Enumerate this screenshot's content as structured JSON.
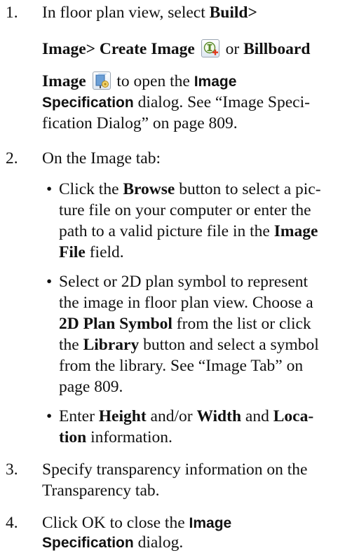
{
  "steps": [
    {
      "number": "1.",
      "lines": [
        {
          "t1": "In floor plan view, select ",
          "b1": "Build>"
        },
        {
          "b1": "Image> Create Image",
          "icon1": "create-image-icon",
          "t2": " or ",
          "b2": "Billboard"
        },
        {
          "b1": "Image",
          "icon1": "billboard-image-icon",
          "t1": " to open the ",
          "s1": "Image"
        },
        {
          "s1": "Specification",
          "t1": " dialog. See “Image Speci-"
        },
        {
          "t1": "fication Dialog” on page 809."
        }
      ]
    },
    {
      "number": "2.",
      "lines": [
        {
          "t1": "On the Image tab:"
        }
      ],
      "bullets": [
        {
          "lines": [
            {
              "t1": "Click the ",
              "b1": "Browse",
              "t2": " button to select a pic-"
            },
            {
              "t1": "ture file on your computer or enter the"
            },
            {
              "t1": "path to a valid picture file in the ",
              "b1": "Image"
            },
            {
              "b1": "File",
              "t1": " field."
            }
          ]
        },
        {
          "lines": [
            {
              "t1": "Select or 2D plan symbol to represent"
            },
            {
              "t1": "the image in floor plan view. Choose a"
            },
            {
              "b1": "2D Plan Symbol",
              "t1": " from the list or click"
            },
            {
              "t1": "the ",
              "b1": "Library",
              "t2": " button and select a symbol"
            },
            {
              "t1": "from the library. See “Image Tab” on"
            },
            {
              "t1": "page 809."
            }
          ]
        },
        {
          "lines": [
            {
              "t1": "Enter ",
              "b1": "Height",
              "t2": " and/or ",
              "b2": "Width",
              "t3": " and ",
              "b3": "Loca-"
            },
            {
              "b1": "tion",
              "t1": " information."
            }
          ]
        }
      ]
    },
    {
      "number": "3.",
      "lines": [
        {
          "t1": "Specify transparency information on the"
        },
        {
          "t1": "Transparency tab."
        }
      ]
    },
    {
      "number": "4.",
      "lines": [
        {
          "t1": "Click OK to close the ",
          "s1": "Image"
        },
        {
          "s1": "Specification",
          "t1": " dialog."
        }
      ]
    }
  ]
}
